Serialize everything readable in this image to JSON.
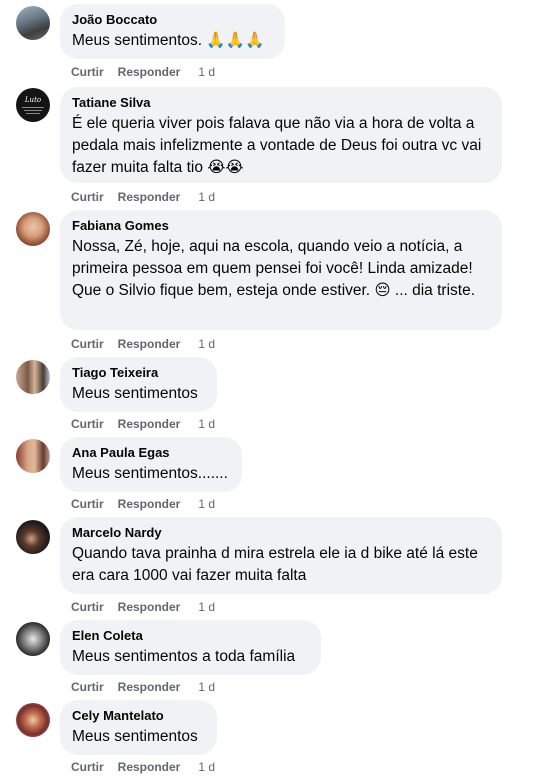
{
  "comments": [
    {
      "author": "João Boccato",
      "text": "Meus sentimentos. 🙏🙏🙏",
      "like": "Curtir",
      "reply": "Responder",
      "time": "1 d"
    },
    {
      "author": "Tatiane Silva",
      "text": "É ele queria viver pois falava que não via a hora de volta a pedala mais infelizmente a vontade de Deus foi outra vc vai fazer muita falta tio 😭😭",
      "like": "Curtir",
      "reply": "Responder",
      "time": "1 d",
      "avatar_text": "Luto"
    },
    {
      "author": "Fabiana Gomes",
      "text": "Nossa, Zé, hoje, aqui na escola, quando veio a notícia, a primeira pessoa em quem pensei foi você! Linda amizade! Que o Silvio fique bem, esteja onde estiver. 😔 ... dia triste.",
      "like": "Curtir",
      "reply": "Responder",
      "time": "1 d"
    },
    {
      "author": "Tiago Teixeira",
      "text": "Meus sentimentos",
      "like": "Curtir",
      "reply": "Responder",
      "time": "1 d"
    },
    {
      "author": "Ana Paula Egas",
      "text": "Meus sentimentos.......",
      "like": "Curtir",
      "reply": "Responder",
      "time": "1 d"
    },
    {
      "author": "Marcelo Nardy",
      "text": "Quando tava prainha d mira estrela ele ia d bike até lá este era cara 1000 vai fazer muita falta",
      "like": "Curtir",
      "reply": "Responder",
      "time": "1 d"
    },
    {
      "author": "Elen Coleta",
      "text": "Meus sentimentos a toda família",
      "like": "Curtir",
      "reply": "Responder",
      "time": "1 d"
    },
    {
      "author": "Cely Mantelato",
      "text": "Meus sentimentos",
      "like": "Curtir",
      "reply": "Responder",
      "time": "1 d"
    }
  ]
}
